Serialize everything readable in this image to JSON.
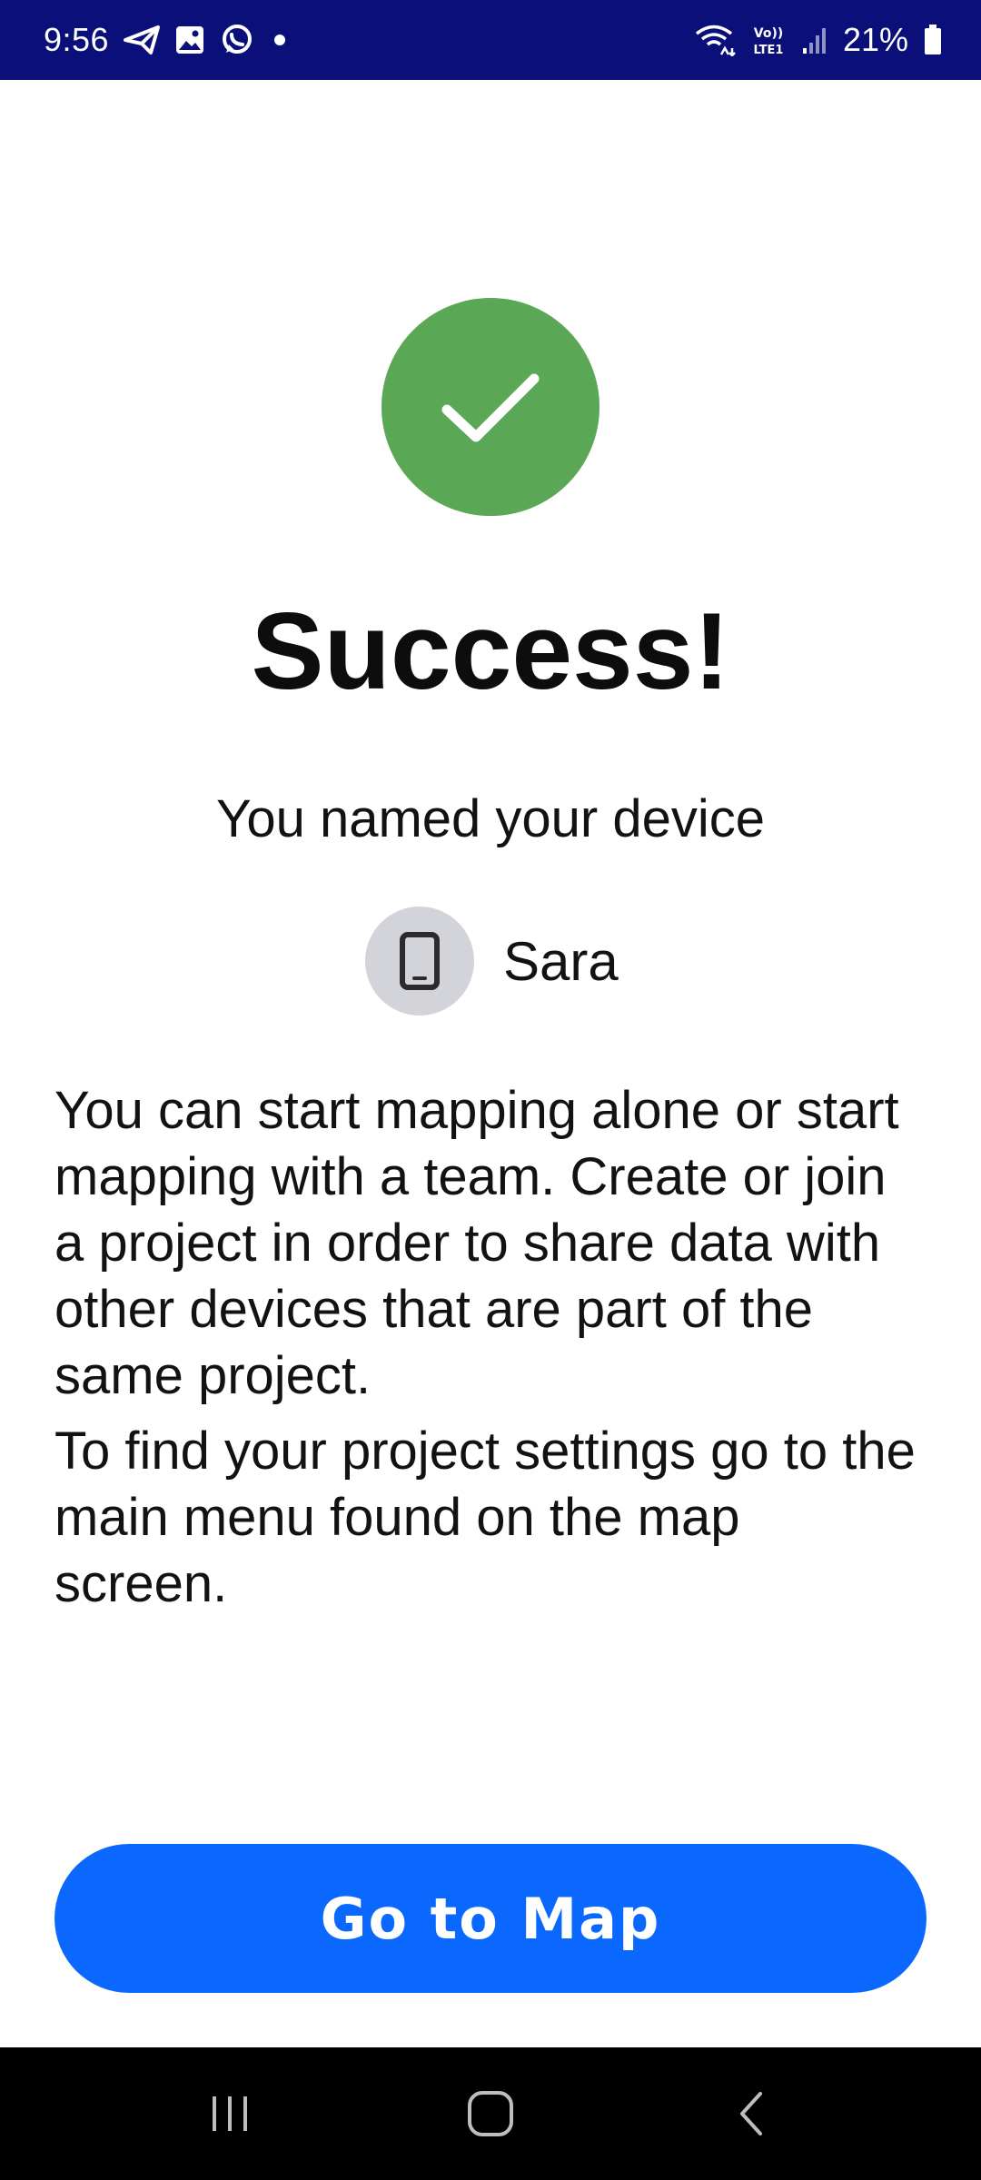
{
  "status_bar": {
    "time": "9:56",
    "battery_percent": "21%",
    "icons": [
      "send-icon",
      "gallery-icon",
      "whatsapp-icon",
      "dot-icon",
      "wifi-icon",
      "volte-icon",
      "signal-icon",
      "battery-icon"
    ]
  },
  "success": {
    "title": "Success!",
    "subtitle": "You named your device",
    "device_name": "Sara",
    "paragraph_1": "You can start mapping alone or start mapping with a team. Create or join a project in order to share data with other devices that are part of the same project.",
    "paragraph_2": "To find your project settings go to the main menu found on the map screen.",
    "button_label": "Go to Map"
  },
  "colors": {
    "status_bar_bg": "#0a0f7a",
    "success_green": "#5aa755",
    "primary_blue": "#0b68ff",
    "avatar_bg": "#d3d4da"
  },
  "nav_bar": {
    "icons": [
      "recents-icon",
      "home-icon",
      "back-icon"
    ]
  }
}
